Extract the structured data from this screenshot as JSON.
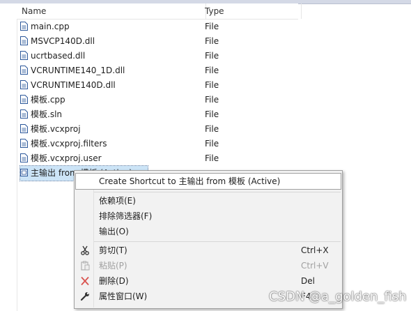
{
  "columns": {
    "name": "Name",
    "type": "Type"
  },
  "files": [
    {
      "name": "main.cpp",
      "type": "File"
    },
    {
      "name": "MSVCP140D.dll",
      "type": "File"
    },
    {
      "name": "ucrtbased.dll",
      "type": "File"
    },
    {
      "name": "VCRUNTIME140_1D.dll",
      "type": "File"
    },
    {
      "name": "VCRUNTIME140D.dll",
      "type": "File"
    },
    {
      "name": "模板.cpp",
      "type": "File"
    },
    {
      "name": "模板.sln",
      "type": "File"
    },
    {
      "name": "模板.vcxproj",
      "type": "File"
    },
    {
      "name": "模板.vcxproj.filters",
      "type": "File"
    },
    {
      "name": "模板.vcxproj.user",
      "type": "File"
    },
    {
      "name": "主输出 from 模板 (Active)",
      "type": ""
    }
  ],
  "context_menu": {
    "create_shortcut": "Create Shortcut to 主输出 from 模板 (Active)",
    "dependencies": "依赖项(E)",
    "exclude_filter": "排除筛选器(F)",
    "output": "输出(O)",
    "cut": {
      "label": "剪切(T)",
      "shortcut": "Ctrl+X",
      "icon": "scissors-icon"
    },
    "paste": {
      "label": "粘贴(P)",
      "shortcut": "Ctrl+V",
      "icon": "clipboard-icon",
      "disabled": true
    },
    "delete": {
      "label": "删除(D)",
      "shortcut": "Del",
      "icon": "delete-x-icon"
    },
    "properties": {
      "label": "属性窗口(W)",
      "shortcut": "F4",
      "icon": "wrench-icon"
    }
  },
  "watermark": "CSDN @a_golden_fish",
  "colors": {
    "selection": "#cce4f7",
    "menu_bg": "#f2f2f2",
    "delete_red": "#d9534f"
  }
}
